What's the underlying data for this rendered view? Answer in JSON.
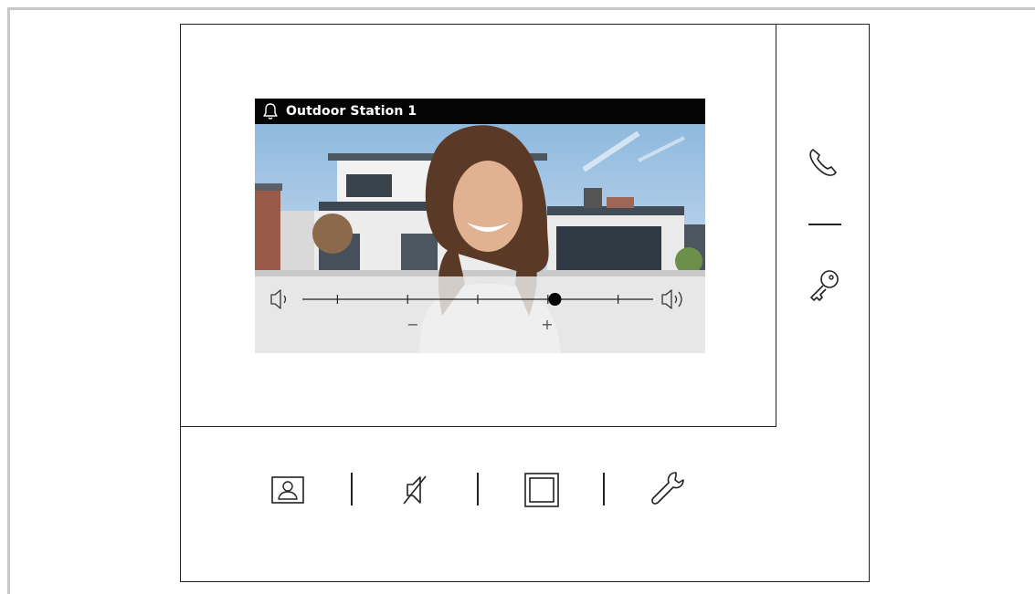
{
  "screen": {
    "title": "Outdoor Station 1",
    "icons": {
      "title": "bell-icon"
    }
  },
  "volume": {
    "level": 0.72,
    "steps": 5,
    "minus_label": "−",
    "plus_label": "+",
    "icons": {
      "low": "speaker-low-icon",
      "high": "speaker-high-icon"
    }
  },
  "side_buttons": [
    {
      "name": "call-button",
      "icon": "phone-icon"
    },
    {
      "name": "unlock-button",
      "icon": "key-icon"
    }
  ],
  "bottom_buttons": [
    {
      "name": "intercom-button",
      "icon": "person-frame-icon"
    },
    {
      "name": "mute-button",
      "icon": "speaker-mute-icon"
    },
    {
      "name": "screen-button",
      "icon": "square-icon"
    },
    {
      "name": "settings-button",
      "icon": "wrench-icon"
    }
  ],
  "colors": {
    "title_bar": "#050505",
    "accent": "#000000",
    "frame": "#c8c8c8"
  }
}
